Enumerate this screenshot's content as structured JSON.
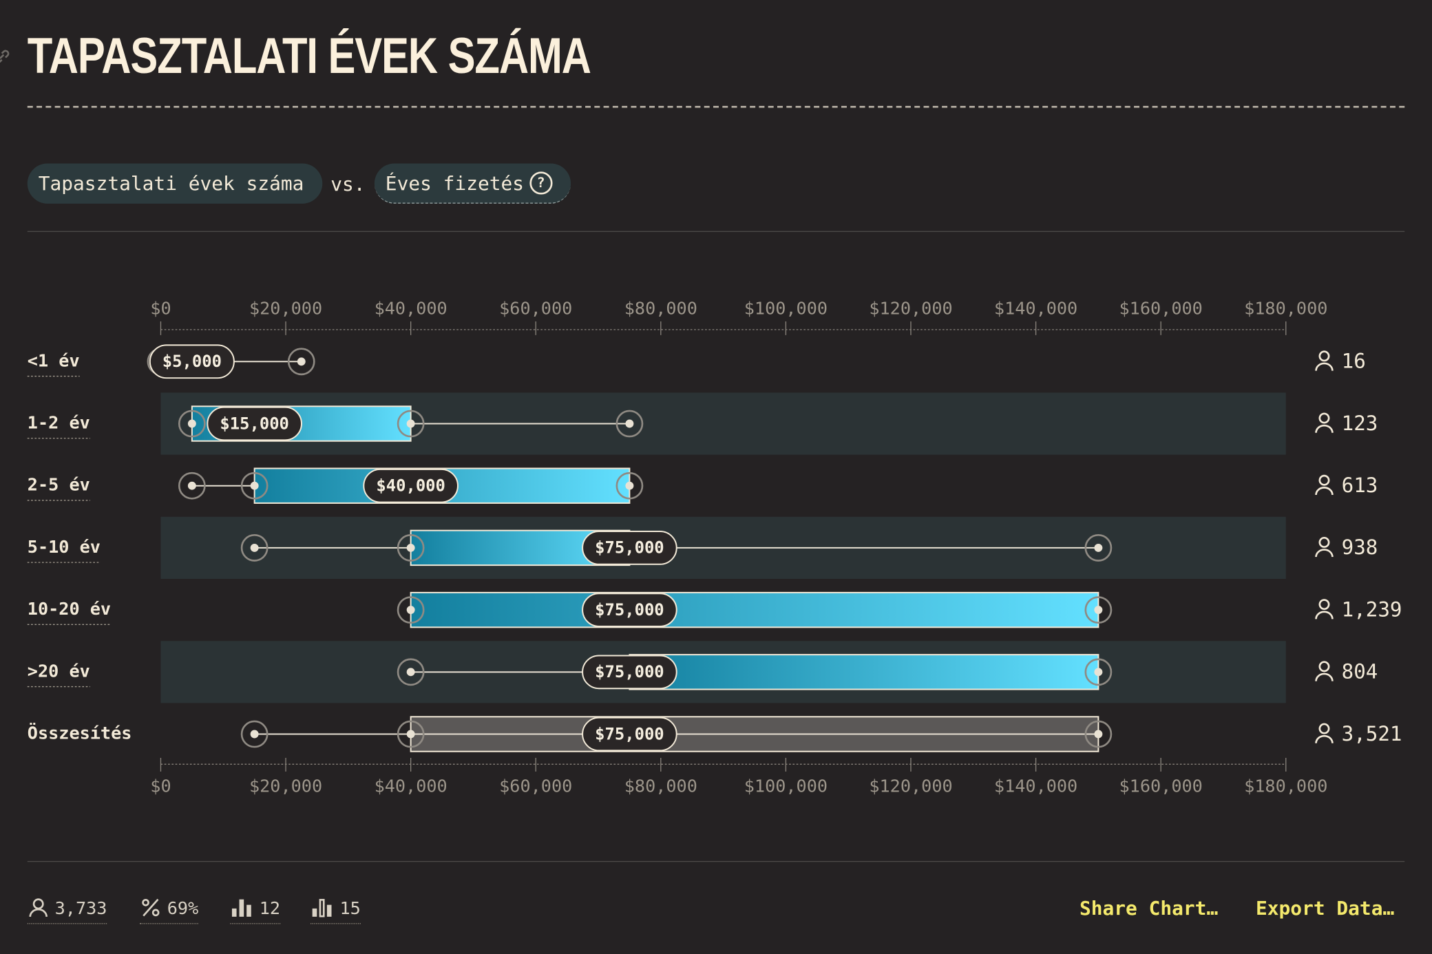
{
  "title": "TAPASZTALATI ÉVEK SZÁMA",
  "selector": {
    "left_label": "Tapasztalati évek száma",
    "vs_label": "vs.",
    "right_label": "Éves fizetés",
    "help_icon": "question-circle-icon"
  },
  "colors": {
    "background": "#252223",
    "row_band": "#2b3335",
    "bar_start": "#137f9e",
    "bar_end": "#63e0ff",
    "total_bar": "#5b5857",
    "accent_link": "#f4e96c"
  },
  "chart_data": {
    "type": "box",
    "title": "",
    "xlabel": "",
    "ylabel": "",
    "xlim": [
      0,
      180000
    ],
    "x_ticks": [
      0,
      20000,
      40000,
      60000,
      80000,
      100000,
      120000,
      140000,
      160000,
      180000
    ],
    "x_tick_labels": [
      "$0",
      "$20,000",
      "$40,000",
      "$60,000",
      "$80,000",
      "$100,000",
      "$120,000",
      "$140,000",
      "$160,000",
      "$180,000"
    ],
    "axis_position": "top and bottom",
    "alternating_row_bands": true,
    "count_icon": "person-icon",
    "rows": [
      {
        "category": "<1 év",
        "min": 0,
        "q1": null,
        "median": 5000,
        "median_label": "$5,000",
        "q3": null,
        "max": 22500,
        "count_label": "16"
      },
      {
        "category": "1-2 év",
        "min": 5000,
        "q1": 5000,
        "median": 15000,
        "median_label": "$15,000",
        "q3": 40000,
        "max": 75000,
        "count_label": "123"
      },
      {
        "category": "2-5 év",
        "min": 5000,
        "q1": 15000,
        "median": 40000,
        "median_label": "$40,000",
        "q3": 75000,
        "max": 75000,
        "count_label": "613"
      },
      {
        "category": "5-10 év",
        "min": 15000,
        "q1": 40000,
        "median": 75000,
        "median_label": "$75,000",
        "q3": 75000,
        "max": 150000,
        "count_label": "938"
      },
      {
        "category": "10-20 év",
        "min": 40000,
        "q1": 40000,
        "median": 75000,
        "median_label": "$75,000",
        "q3": 150000,
        "max": 150000,
        "count_label": "1,239"
      },
      {
        "category": ">20 év",
        "min": 40000,
        "q1": 75000,
        "median": 75000,
        "median_label": "$75,000",
        "q3": 150000,
        "max": 150000,
        "count_label": "804"
      },
      {
        "category": "Összesítés",
        "min": 15000,
        "q1": 40000,
        "median": 75000,
        "median_label": "$75,000",
        "q3": 150000,
        "max": 150000,
        "count_label": "3,521",
        "is_total": true
      }
    ]
  },
  "footer": {
    "respondents": "3,733",
    "percent": "69%",
    "stat_a": "12",
    "stat_b": "15",
    "share_label": "Share Chart…",
    "export_label": "Export Data…"
  }
}
